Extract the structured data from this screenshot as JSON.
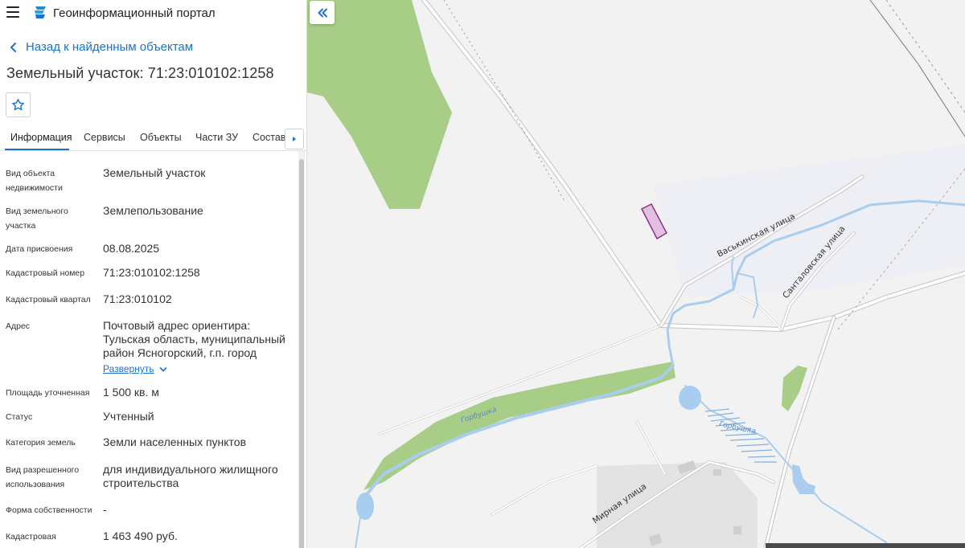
{
  "app": {
    "title": "Геоинформационный портал"
  },
  "nav": {
    "back_label": "Назад к найденным объектам"
  },
  "object": {
    "title": "Земельный участок: 71:23:010102:1258"
  },
  "tabs": [
    {
      "label": "Информация",
      "active": true
    },
    {
      "label": "Сервисы"
    },
    {
      "label": "Объекты"
    },
    {
      "label": "Части ЗУ"
    },
    {
      "label": "Состав"
    }
  ],
  "attributes": [
    {
      "key": "Вид объекта недвижимости",
      "value": "Земельный участок"
    },
    {
      "key": "Вид земельного участка",
      "value": "Землепользование"
    },
    {
      "key": "Дата присвоения",
      "value": "08.08.2025"
    },
    {
      "key": "Кадастровый номер",
      "value": "71:23:010102:1258"
    },
    {
      "key": "Кадастровый квартал",
      "value": "71:23:010102"
    },
    {
      "key": "Адрес",
      "value": "Почтовый адрес ориентира: Тульская область, муниципальный район Ясногорский, г.п. город",
      "expand_label": "Развернуть"
    },
    {
      "key": "Площадь уточненная",
      "value": "1 500 кв. м"
    },
    {
      "key": "Статус",
      "value": "Учтенный"
    },
    {
      "key": "Категория земель",
      "value": "Земли населенных пунктов"
    },
    {
      "key": "Вид разрешенного использования",
      "value": "для индивидуального жилищного строительства"
    },
    {
      "key": "Форма собственности",
      "value": "-"
    },
    {
      "key": "Кадастровая",
      "value": "1 463 490 руб."
    }
  ],
  "map": {
    "streets": {
      "vaskinskaya": "Васькинская улица",
      "santalovskaya": "Санталовская улица",
      "mirnaya": "Мирная улица"
    },
    "water": {
      "river": "Горбушка",
      "pond": "Горбушка"
    },
    "colors": {
      "parcel_fill": "#e2bfe0",
      "parcel_stroke": "#8a2a86",
      "forest": "#a8cd87",
      "water": "#a9cdee",
      "accent": "#1a73c9"
    }
  },
  "icons": [
    "menu-icon",
    "portal-logo-icon",
    "chevron-left-icon",
    "star-outline-icon",
    "caret-right-icon",
    "chevron-down-icon",
    "double-chevron-left-icon"
  ]
}
